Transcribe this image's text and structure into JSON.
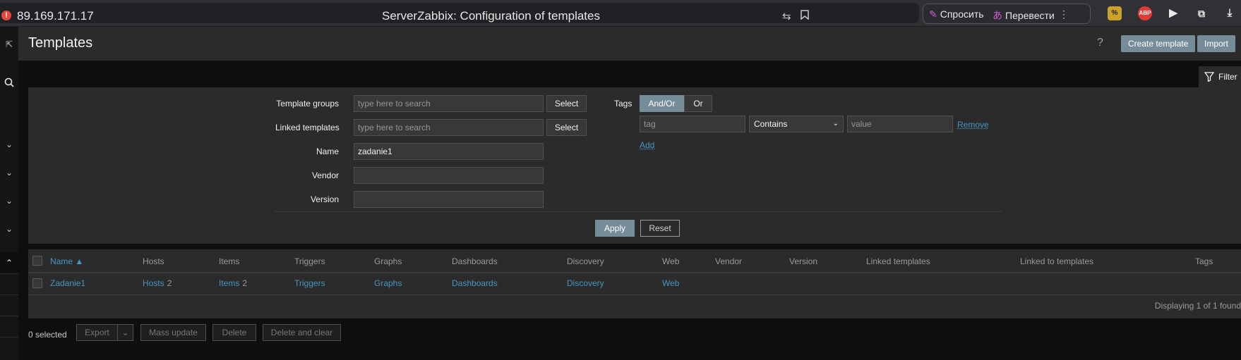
{
  "browser": {
    "url": "89.169.171.17",
    "tab_title": "ServerZabbix: Configuration of templates",
    "ask_label": "Спросить",
    "translate_label": "Перевести",
    "abp_label": "ABP"
  },
  "sidebar": {
    "chevron": "⌄",
    "chevron_up": "⌃"
  },
  "header": {
    "title": "Templates",
    "help": "?",
    "create_label": "Create template",
    "import_label": "Import"
  },
  "filter": {
    "tab_label": "Filter",
    "template_groups_label": "Template groups",
    "template_groups_placeholder": "type here to search",
    "linked_templates_label": "Linked templates",
    "linked_templates_placeholder": "type here to search",
    "select_label": "Select",
    "name_label": "Name",
    "name_value": "zadanie1",
    "vendor_label": "Vendor",
    "vendor_value": "",
    "version_label": "Version",
    "version_value": "",
    "tags_label": "Tags",
    "and_or_label": "And/Or",
    "or_label": "Or",
    "tag_placeholder": "tag",
    "operator_value": "Contains",
    "value_placeholder": "value",
    "remove_label": "Remove",
    "add_label": "Add",
    "apply_label": "Apply",
    "reset_label": "Reset"
  },
  "table": {
    "headers": {
      "name": "Name ▲",
      "hosts": "Hosts",
      "items": "Items",
      "triggers": "Triggers",
      "graphs": "Graphs",
      "dashboards": "Dashboards",
      "discovery": "Discovery",
      "web": "Web",
      "vendor": "Vendor",
      "version": "Version",
      "linked_templates": "Linked templates",
      "linked_to_templates": "Linked to templates",
      "tags": "Tags"
    },
    "rows": [
      {
        "name": "Zadanie1",
        "hosts": "Hosts",
        "hosts_count": "2",
        "items": "Items",
        "items_count": "2",
        "triggers": "Triggers",
        "graphs": "Graphs",
        "dashboards": "Dashboards",
        "discovery": "Discovery",
        "web": "Web"
      }
    ],
    "displaying": "Displaying 1 of 1 found"
  },
  "footer": {
    "selected": "0 selected",
    "export_label": "Export",
    "mass_update_label": "Mass update",
    "delete_label": "Delete",
    "delete_clear_label": "Delete and clear"
  },
  "colors": {
    "accent": "#768d99",
    "link": "#4796c4",
    "background": "#0e0e0e",
    "panel": "#2b2b2b"
  }
}
